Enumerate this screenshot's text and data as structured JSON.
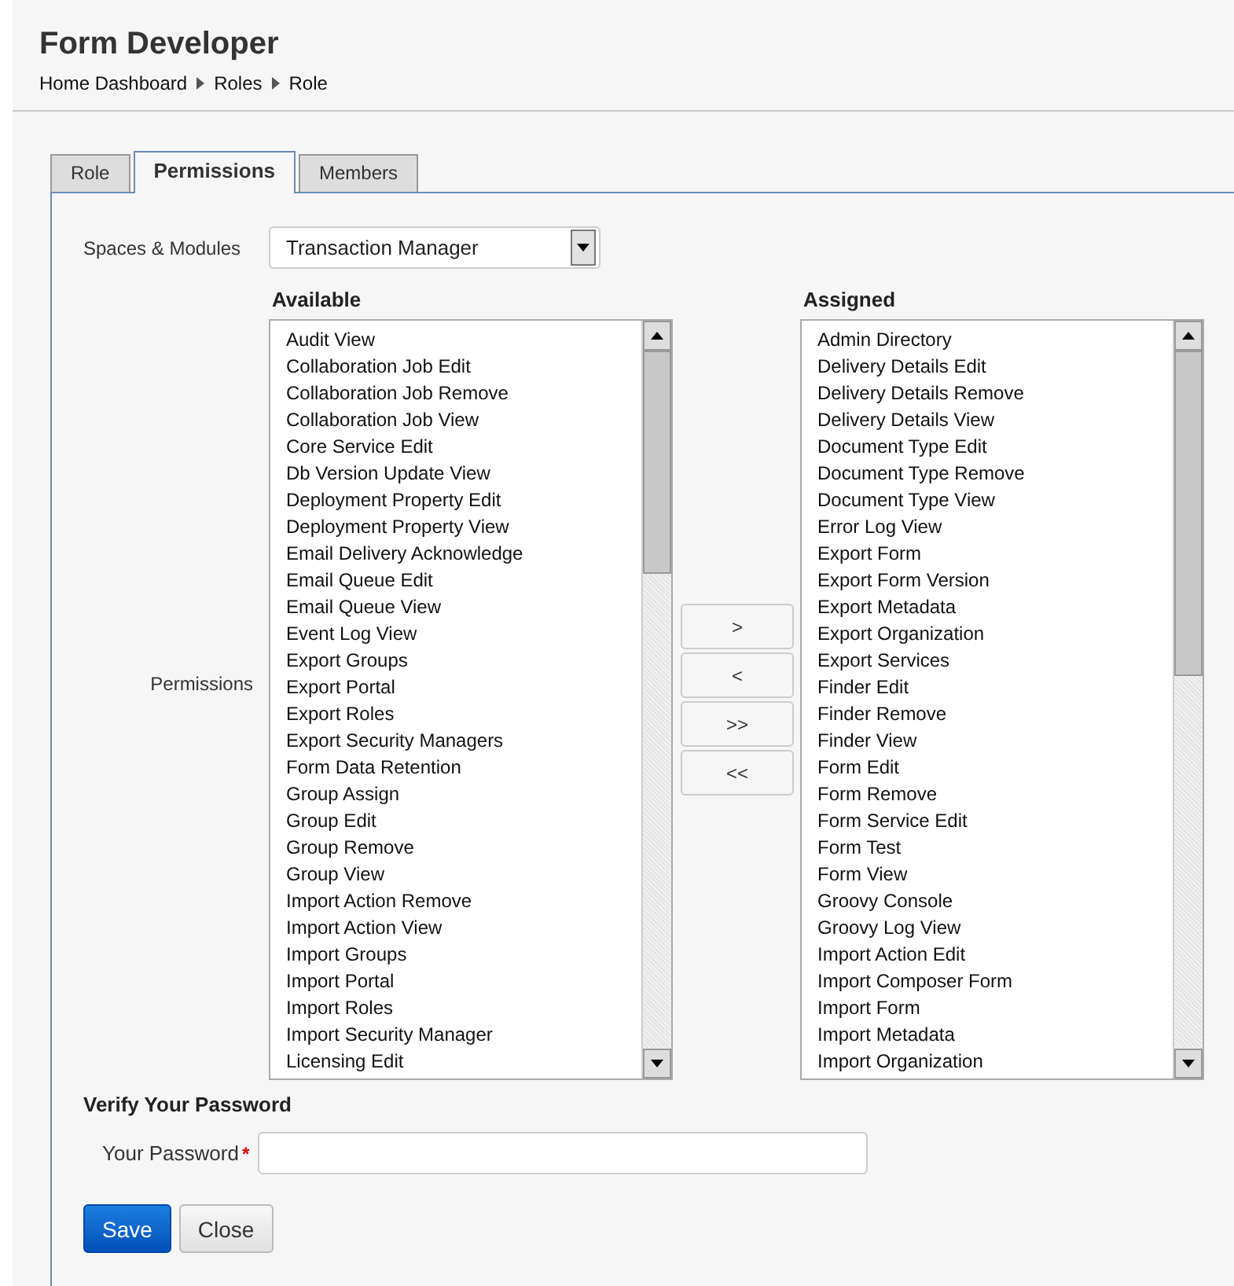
{
  "header": {
    "title": "Form Developer",
    "breadcrumbs": [
      "Home Dashboard",
      "Roles",
      "Role"
    ]
  },
  "tabs": [
    {
      "label": "Role",
      "selected": false
    },
    {
      "label": "Permissions",
      "selected": true
    },
    {
      "label": "Members",
      "selected": false
    }
  ],
  "spaces_modules": {
    "label": "Spaces & Modules",
    "value": "Transaction Manager"
  },
  "permissions": {
    "label": "Permissions",
    "available": {
      "heading": "Available",
      "items": [
        "Audit View",
        "Collaboration Job Edit",
        "Collaboration Job Remove",
        "Collaboration Job View",
        "Core Service Edit",
        "Db Version Update View",
        "Deployment Property Edit",
        "Deployment Property View",
        "Email Delivery Acknowledge",
        "Email Queue Edit",
        "Email Queue View",
        "Event Log View",
        "Export Groups",
        "Export Portal",
        "Export Roles",
        "Export Security Managers",
        "Form Data Retention",
        "Group Assign",
        "Group Edit",
        "Group Remove",
        "Group View",
        "Import Action Remove",
        "Import Action View",
        "Import Groups",
        "Import Portal",
        "Import Roles",
        "Import Security Manager",
        "Licensing Edit"
      ]
    },
    "move_buttons": [
      ">",
      "<",
      ">>",
      "<<"
    ],
    "assigned": {
      "heading": "Assigned",
      "items": [
        "Admin Directory",
        "Delivery Details Edit",
        "Delivery Details Remove",
        "Delivery Details View",
        "Document Type Edit",
        "Document Type Remove",
        "Document Type View",
        "Error Log View",
        "Export Form",
        "Export Form Version",
        "Export Metadata",
        "Export Organization",
        "Export Services",
        "Finder Edit",
        "Finder Remove",
        "Finder View",
        "Form Edit",
        "Form Remove",
        "Form Service Edit",
        "Form Test",
        "Form View",
        "Groovy Console",
        "Groovy Log View",
        "Import Action Edit",
        "Import Composer Form",
        "Import Form",
        "Import Metadata",
        "Import Organization"
      ]
    }
  },
  "verify": {
    "heading": "Verify Your Password",
    "label": "Your Password",
    "required_mark": "*"
  },
  "buttons": [
    {
      "label": "Save",
      "kind": "primary"
    },
    {
      "label": "Close",
      "kind": "secondary"
    }
  ]
}
